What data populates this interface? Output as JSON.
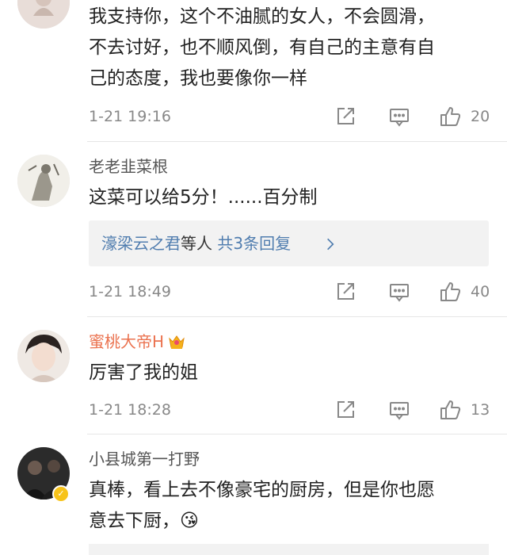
{
  "comments": [
    {
      "username": "",
      "text": "我支持你，这个不油腻的女人，不会圆滑，不去讨好，也不顺风倒，有自己的主意有自己的态度，我也要像你一样",
      "lines": [
        "我支持你，这个不油腻的女人，不会圆滑，",
        "不去讨好，也不顺风倒，有自己的主意有自",
        "己的态度，我也要像你一样"
      ],
      "time": "1-21 19:16",
      "likes": "20"
    },
    {
      "username": "老老韭菜根",
      "text": "这菜可以给5分！......百分制",
      "time": "1-21 18:49",
      "likes": "40",
      "replies": {
        "names": "濠梁云之君",
        "suffix": "等人",
        "count": "共3条回复"
      }
    },
    {
      "username": "蜜桃大帝H",
      "text": "厉害了我的姐",
      "time": "1-21 18:28",
      "likes": "13"
    },
    {
      "username": "小县城第一打野",
      "lines": [
        "真棒，看上去不像豪宅的厨房，但是你也愿",
        "意去下厨，😘"
      ],
      "text": "真棒，看上去不像豪宅的厨房，但是你也愿意去下厨，😘"
    }
  ],
  "icons": {
    "share": "share-icon",
    "reply": "comment-icon",
    "like": "thumbs-up-icon",
    "chevron": "chevron-right-icon",
    "crown": "crown-badge-icon",
    "verified": "verified-badge-icon"
  },
  "colors": {
    "vip_name": "#eb7350",
    "link": "#507daf",
    "meta": "#888888",
    "reply_bg": "#f2f2f2"
  }
}
